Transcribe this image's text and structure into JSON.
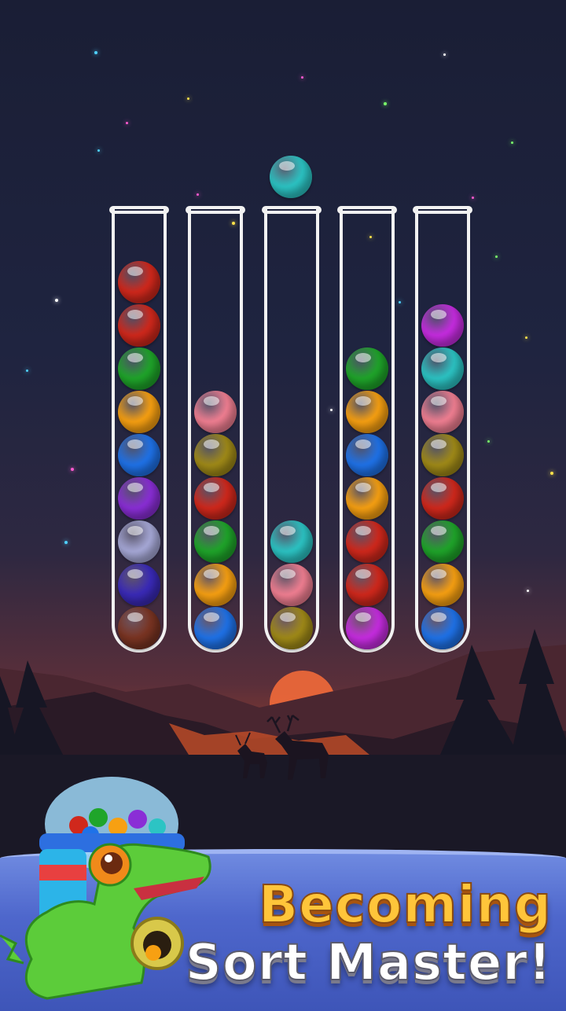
{
  "game": {
    "held_ball": "cyan",
    "tubes": [
      {
        "balls": [
          "red",
          "red",
          "green",
          "orange",
          "blue",
          "purple",
          "lavender",
          "indigo",
          "brown"
        ]
      },
      {
        "balls": [
          "pink",
          "olive",
          "red",
          "green",
          "orange",
          "blue"
        ]
      },
      {
        "balls": [
          "cyan",
          "pink",
          "olive"
        ]
      },
      {
        "balls": [
          "green",
          "orange",
          "blue",
          "orange",
          "red",
          "red",
          "magenta"
        ]
      },
      {
        "balls": [
          "magenta",
          "cyan",
          "pink",
          "olive",
          "red",
          "green",
          "orange",
          "blue"
        ]
      }
    ]
  },
  "colors": {
    "red": "#d0281c",
    "green": "#1fa52a",
    "orange": "#f7a012",
    "blue": "#1f72e8",
    "purple": "#8a2ed6",
    "lavender": "#a7a9d8",
    "indigo": "#3a2ab8",
    "brown": "#7a3422",
    "pink": "#f17f92",
    "olive": "#a08a18",
    "cyan": "#2cc4c4",
    "magenta": "#c62ce0"
  },
  "icons": {
    "mascot": "crocodile-gumball-machine-icon",
    "moon": "setting-sun-icon",
    "deer": "deer-silhouette-icon"
  },
  "promo": {
    "line1": "Becoming",
    "line2": "Sort Master!"
  }
}
